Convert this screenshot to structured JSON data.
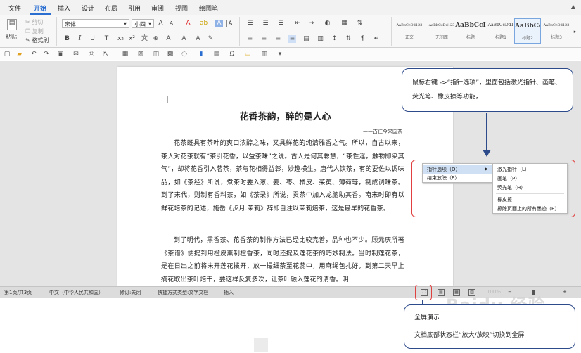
{
  "tabs": [
    "文件",
    "开始",
    "插入",
    "设计",
    "布局",
    "引用",
    "审阅",
    "视图",
    "绘图笔"
  ],
  "active_tab": "开始",
  "ribbon": {
    "paste_label": "粘贴",
    "cut_label": "剪切",
    "copy_label": "复制",
    "format_painter_label": "格式刷",
    "font_name": "宋体",
    "font_size": "小四",
    "bold": "B",
    "italic": "I",
    "underline": "U",
    "styles": [
      {
        "preview": "AaBbCcDd123",
        "name": "正文"
      },
      {
        "preview": "AaBbCcDd123",
        "name": "无间距"
      },
      {
        "preview": "AaBbCcI",
        "name": "标题"
      },
      {
        "preview": "AaBbCcDd1",
        "name": "标题1"
      },
      {
        "preview": "AaBbCc",
        "name": "标题2"
      },
      {
        "preview": "AaBbCcDd123",
        "name": "标题3"
      }
    ]
  },
  "document": {
    "title": "花香茶韵，醉的是人心",
    "source": "——古往今来国茶",
    "paragraphs": [
      "花茶既具有茶叶的爽口浓醇之味，又具鲜花的纯清雅香之气。所以，自古以来，茶人对花茶就有“茶引花香，以益茶味”之说。古人是何其聪慧，“茶性淫，触物即染其气”，却将花香引入茗茶，茶与花相得益彰，妙趣横生。唐代人饮茶，有的要佐以调味品，如《茶经》所说，煮茶时要入葱、姜、枣、橘皮、茱萸、薄荷等，制成调味茶。到了宋代，则制有香料茶，如《茶录》所说，贡茶中加入龙脑助其香。南宋时即有以鲜花培茶的记述，施岳《步月.茉莉》辞即自注以茉莉焙茶，这是最早的花香茶。",
      "到了明代，熏香茶、花香茶的制作方法已经比较完善，品种也不少。顾元庆所著《茶谱》便提到用橙皮熏制橙香茶，同时还提及莲花茶的巧妙制法。当时制莲花茶，是在日出之前将未开莲花拨开，放一撮细茶至花蕊中，用麻绳包扎好，到第二天早上摘花取出茶叶焙干，要这样反复多次，让茶叶融入莲花的清香。明"
    ]
  },
  "callout_top": "鼠标右键 ->“指针选项”，里面包括激光指针、画笔、荧光笔、橡皮擦等功能，",
  "context_menu": {
    "items": [
      "指针选项（O）",
      "结束放映（E）"
    ],
    "submenu": [
      "激光指针（L）",
      "画笔（P）",
      "荧光笔（H）",
      "橡皮擦",
      "擦除页面上的所有墨迹（E）"
    ]
  },
  "statusbar": {
    "page": "第1页/共3页",
    "language": "中文（中华人民共和国）",
    "revision": "修订:关闭",
    "format_type": "快捷方式类型:文字文档",
    "insert": "插入",
    "zoom": "100%"
  },
  "callout_bottom": {
    "title": "全屏演示",
    "text": "文档底部状态栏“放大/放映”切换到全屏"
  },
  "watermark": "Baidu 经验",
  "colors": {
    "accent": "#2a6ed2",
    "callout_border": "#2d4a8a",
    "highlight_red": "#e04040"
  }
}
